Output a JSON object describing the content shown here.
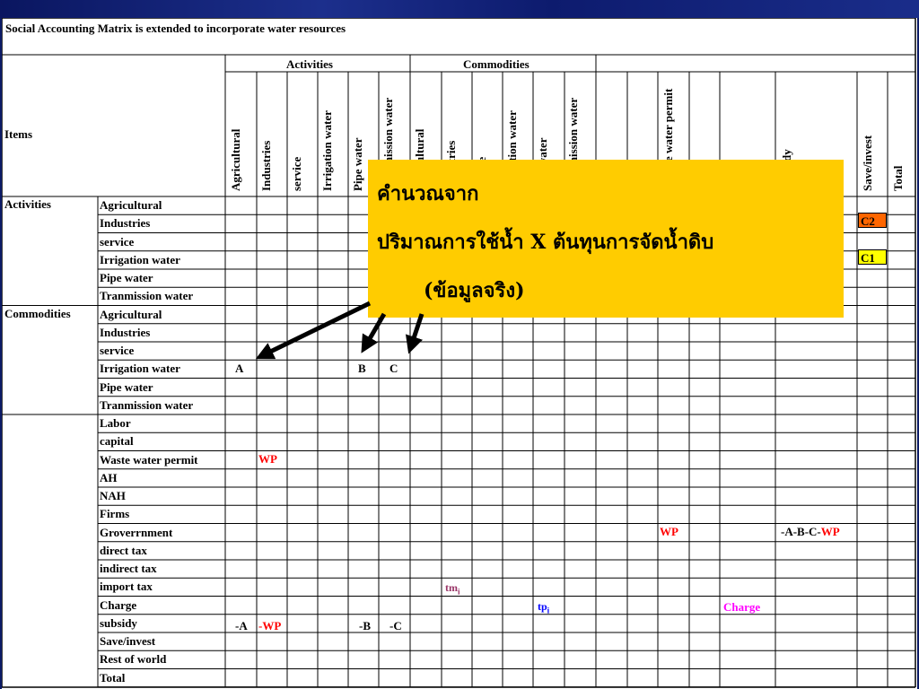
{
  "title": "Social Accounting Matrix    is extended to incorporate water resources",
  "header": {
    "items_label": "Items",
    "activities_label": "Activities",
    "commodities_label": "Commodities",
    "activity_columns": [
      "Agricultural",
      "Industries",
      "service",
      "Irrigation  water",
      "Pipe water",
      "Tranmission water"
    ],
    "commodity_columns": [
      "Agricultural",
      "Industries",
      "service",
      "Irrigation  water",
      "Pipe water",
      "Tranmission water"
    ],
    "other_columns_visible": [
      "e water permit",
      "dy",
      "Save/invest",
      "Total"
    ]
  },
  "row_groups": {
    "activities": "Activities",
    "commodities": "Commodities"
  },
  "rows": [
    "Agricultural",
    "Industries",
    "service",
    "Irrigation  water",
    "Pipe water",
    "Tranmission water",
    "Agricultural",
    "Industries",
    "service",
    "Irrigation  water",
    "Pipe water",
    "Tranmission water",
    "Labor",
    "capital",
    "Waste water permit",
    "AH",
    "NAH",
    "Firms",
    "Groverrnment",
    "direct tax",
    "indirect tax",
    "import tax",
    "Charge",
    "subsidy",
    "Save/invest",
    "Rest of world",
    "Total"
  ],
  "cells": {
    "A": "A",
    "B": "B",
    "C": "C",
    "wp_row": "WP",
    "gov_wp": "WP",
    "gov_formula_a": "-A-B-C-",
    "gov_formula_b": "WP",
    "tm": "tm",
    "tm_sub": "i",
    "tp": "tp",
    "tp_sub": "i",
    "charge": "Charge",
    "sub_a": "-A",
    "sub_wp": "-WP",
    "sub_b": "-B",
    "sub_c": "-C",
    "c2": "C2",
    "c1": "C1"
  },
  "colors": {
    "c2_fill": "#ff6600",
    "c1_fill": "#ffff00",
    "callout_fill": "#ffcc00",
    "background": "#0b1a66"
  },
  "callout": {
    "line1": "คำนวณจาก",
    "line2": "ปริมาณการใช้น้ำ X ต้นทุนการจัดน้ำดิบ",
    "line3": "(ข้อมูลจริง)"
  }
}
